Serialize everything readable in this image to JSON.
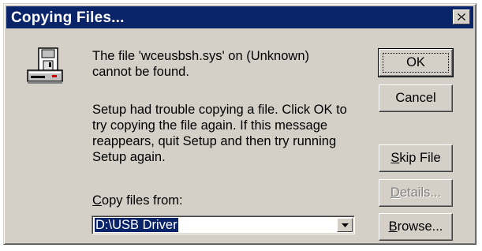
{
  "window": {
    "title": "Copying Files..."
  },
  "message": {
    "line1": "The file 'wceusbsh.sys' on (Unknown)\ncannot be found.",
    "line2": "Setup had trouble copying a file. Click OK to\ntry copying the file again. If this message\nreappears, quit Setup and then try running\nSetup again."
  },
  "copy_from": {
    "label_prefix": "C",
    "label_rest": "opy files from:",
    "value": "D:\\USB Driver"
  },
  "buttons": {
    "ok": "OK",
    "cancel": "Cancel",
    "skip_prefix": "S",
    "skip_rest": "kip File",
    "details_prefix": "D",
    "details_rest": "etails...",
    "browse_prefix": "B",
    "browse_rest": "rowse..."
  },
  "icons": {
    "title_close": "close-icon",
    "disk": "floppy-drive-icon",
    "dropdown": "chevron-down-icon"
  },
  "colors": {
    "titlebar": "#0a246a",
    "dialog_face": "#d4d0c8",
    "selection": "#0a246a"
  }
}
